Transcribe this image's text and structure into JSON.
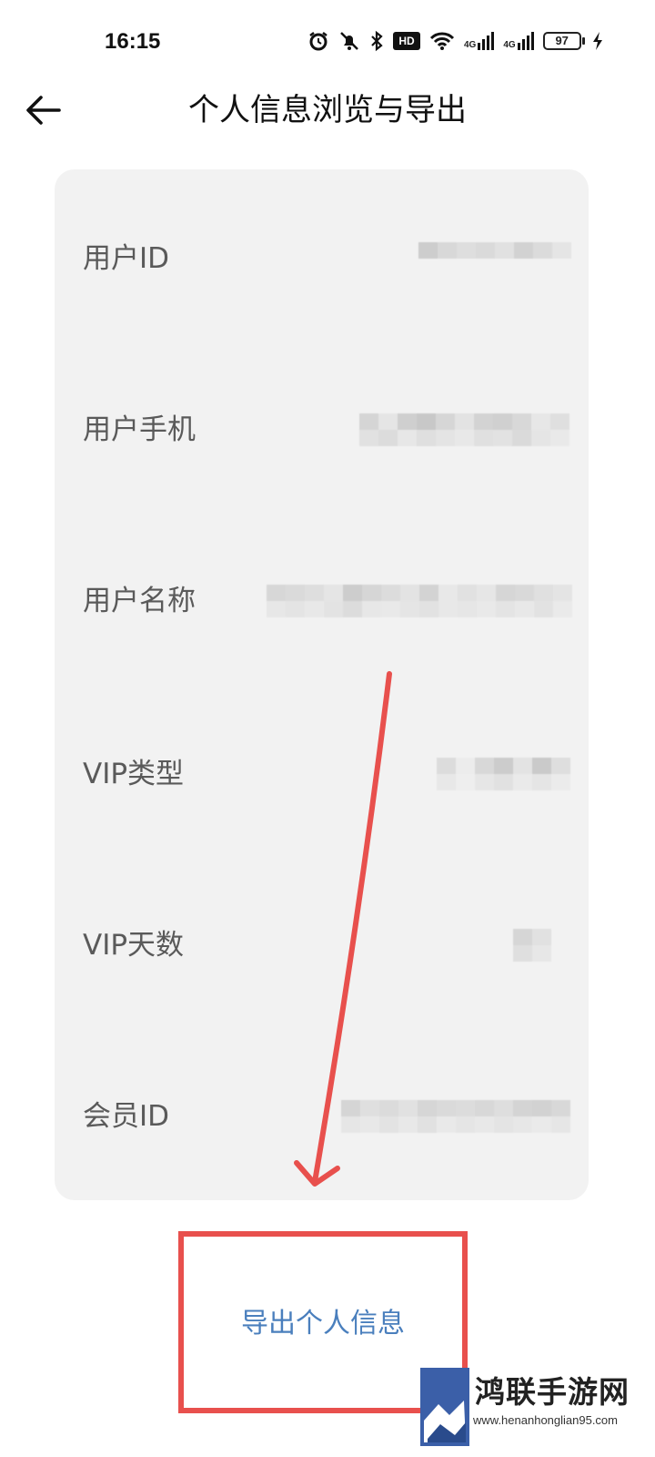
{
  "status_bar": {
    "time": "16:15",
    "battery": "97",
    "network_1": "4G",
    "network_2": "4G",
    "hd_badge": "HD",
    "icons": [
      "alarm-icon",
      "mute-bell-icon",
      "bluetooth-icon",
      "hd-voice-icon",
      "wifi-icon",
      "signal-icon",
      "signal-icon",
      "battery-icon",
      "charging-icon"
    ]
  },
  "header": {
    "title": "个人信息浏览与导出",
    "back_icon": "arrow-left-icon"
  },
  "info_rows": [
    {
      "label": "用户ID"
    },
    {
      "label": "用户手机"
    },
    {
      "label": "用户名称"
    },
    {
      "label": "VIP类型"
    },
    {
      "label": "VIP天数"
    },
    {
      "label": "会员ID"
    }
  ],
  "export": {
    "label": "导出个人信息"
  },
  "colors": {
    "card_bg": "#f2f2f2",
    "label_color": "#5a5a5a",
    "link_blue": "#4a7fbd",
    "annotation_red": "#e8504d"
  },
  "watermark": {
    "text": "鸿联手游网",
    "url": "www.henanhonglian95.com"
  }
}
